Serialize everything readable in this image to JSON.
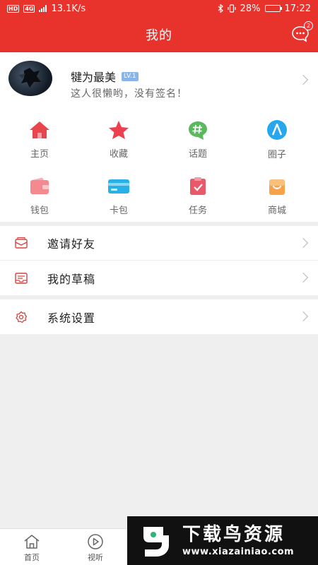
{
  "status_bar": {
    "hd_tag": "HD",
    "network_tag": "4G",
    "speed": "13.1K/s",
    "battery": "28%",
    "battery_level": 0.28,
    "time": "17:22"
  },
  "header": {
    "title": "我的",
    "message_badge": "2"
  },
  "profile": {
    "username": "犍为最美",
    "level": "LV.1",
    "signature": "这人很懒哟，没有签名！"
  },
  "grid": [
    {
      "label": "主页",
      "icon": "home-icon",
      "color": "#e8464c"
    },
    {
      "label": "收藏",
      "icon": "star-icon",
      "color": "#ee3f4f"
    },
    {
      "label": "话题",
      "icon": "hashtag-icon",
      "color": "#5bb85d"
    },
    {
      "label": "圈子",
      "icon": "circle-icon",
      "color": "#27a7ee"
    },
    {
      "label": "钱包",
      "icon": "wallet-icon",
      "color": "#f48a8f"
    },
    {
      "label": "卡包",
      "icon": "card-icon",
      "color": "#2ab0e8"
    },
    {
      "label": "任务",
      "icon": "task-icon",
      "color": "#e85a6a"
    },
    {
      "label": "商城",
      "icon": "shop-icon",
      "color": "#f7a34c"
    }
  ],
  "menu": {
    "invite_friends": "邀请好友",
    "my_drafts": "我的草稿",
    "system_settings": "系统设置"
  },
  "tabbar": {
    "home": "首页",
    "video": "视听"
  },
  "watermark": {
    "title": "下载鸟资源",
    "url": "www.xiazainiao.com"
  },
  "colors": {
    "brand_red": "#e8322c",
    "background": "#efefef"
  }
}
